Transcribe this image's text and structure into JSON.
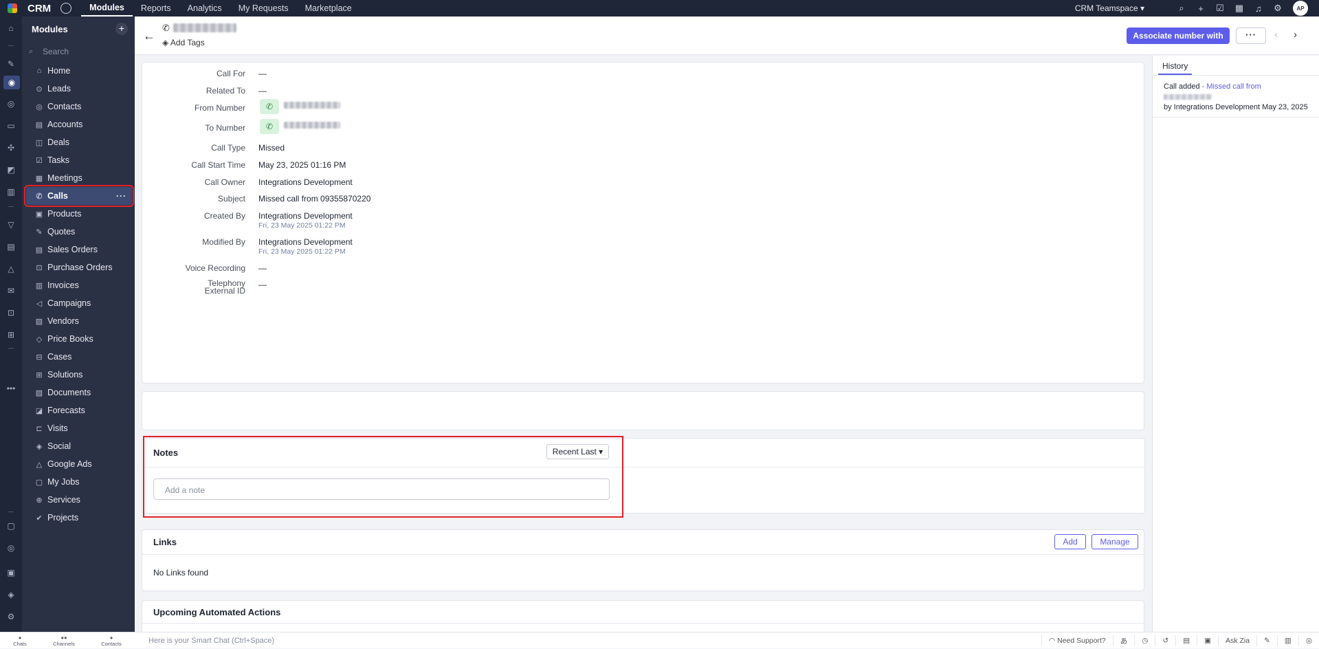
{
  "topbar": {
    "brand": "CRM",
    "nav": [
      "Modules",
      "Reports",
      "Analytics",
      "My Requests",
      "Marketplace"
    ],
    "team": "CRM Teamspace ▾",
    "avatar": "AP"
  },
  "modules": {
    "title": "Modules",
    "search_placeholder": "Search",
    "items": [
      {
        "label": "Home",
        "icon": "⌂"
      },
      {
        "label": "Leads",
        "icon": "⊙"
      },
      {
        "label": "Contacts",
        "icon": "◎"
      },
      {
        "label": "Accounts",
        "icon": "▤"
      },
      {
        "label": "Deals",
        "icon": "◫"
      },
      {
        "label": "Tasks",
        "icon": "☑"
      },
      {
        "label": "Meetings",
        "icon": "▦"
      },
      {
        "label": "Calls",
        "icon": "✆"
      },
      {
        "label": "Products",
        "icon": "▣"
      },
      {
        "label": "Quotes",
        "icon": "✎"
      },
      {
        "label": "Sales Orders",
        "icon": "▤"
      },
      {
        "label": "Purchase Orders",
        "icon": "⊡"
      },
      {
        "label": "Invoices",
        "icon": "▥"
      },
      {
        "label": "Campaigns",
        "icon": "◁"
      },
      {
        "label": "Vendors",
        "icon": "▨"
      },
      {
        "label": "Price Books",
        "icon": "◇"
      },
      {
        "label": "Cases",
        "icon": "⊟"
      },
      {
        "label": "Solutions",
        "icon": "⊞"
      },
      {
        "label": "Documents",
        "icon": "▧"
      },
      {
        "label": "Forecasts",
        "icon": "◪"
      },
      {
        "label": "Visits",
        "icon": "⊏"
      },
      {
        "label": "Social",
        "icon": "◈"
      },
      {
        "label": "Google Ads",
        "icon": "△"
      },
      {
        "label": "My Jobs",
        "icon": "▢"
      },
      {
        "label": "Services",
        "icon": "⊕"
      },
      {
        "label": "Projects",
        "icon": "✔"
      }
    ],
    "active_dots": "···"
  },
  "header": {
    "add_tags": "Add Tags",
    "associate_button": "Associate number with",
    "more_button": "···"
  },
  "details": {
    "fields": [
      {
        "label": "Call For",
        "value": "—"
      },
      {
        "label": "Related To",
        "value": "—"
      },
      {
        "label": "From Number",
        "value": ""
      },
      {
        "label": "To Number",
        "value": ""
      },
      {
        "label": "Call Type",
        "value": "Missed"
      },
      {
        "label": "Call Start Time",
        "value": "May 23, 2025 01:16 PM"
      },
      {
        "label": "Call Owner",
        "value": "Integrations Development"
      },
      {
        "label": "Subject",
        "value": "Missed call from 09355870220"
      },
      {
        "label": "Created By",
        "value": "Integrations Development",
        "sub": "Fri, 23 May 2025 01:22 PM"
      },
      {
        "label": "Modified By",
        "value": "Integrations Development",
        "sub": "Fri, 23 May 2025 01:22 PM"
      },
      {
        "label": "Voice Recording",
        "value": "—"
      },
      {
        "label": "Telephony External ID",
        "value": "—"
      }
    ]
  },
  "notes": {
    "title": "Notes",
    "sort": "Recent Last ▾",
    "placeholder": "Add a note"
  },
  "links": {
    "title": "Links",
    "add": "Add",
    "manage": "Manage",
    "empty": "No Links found"
  },
  "automated": {
    "title": "Upcoming Automated Actions"
  },
  "history": {
    "tab": "History",
    "action": "Call added",
    "link": "- Missed call from",
    "by": "by Integrations Development",
    "date": "May 23, 2025"
  },
  "bottombar": {
    "chats": "Chats",
    "channels": "Channels",
    "contacts": "Contacts",
    "smart_chat": "Here is your Smart Chat (Ctrl+Space)",
    "support": "Need Support?",
    "ask_zia": "Ask Zia"
  }
}
